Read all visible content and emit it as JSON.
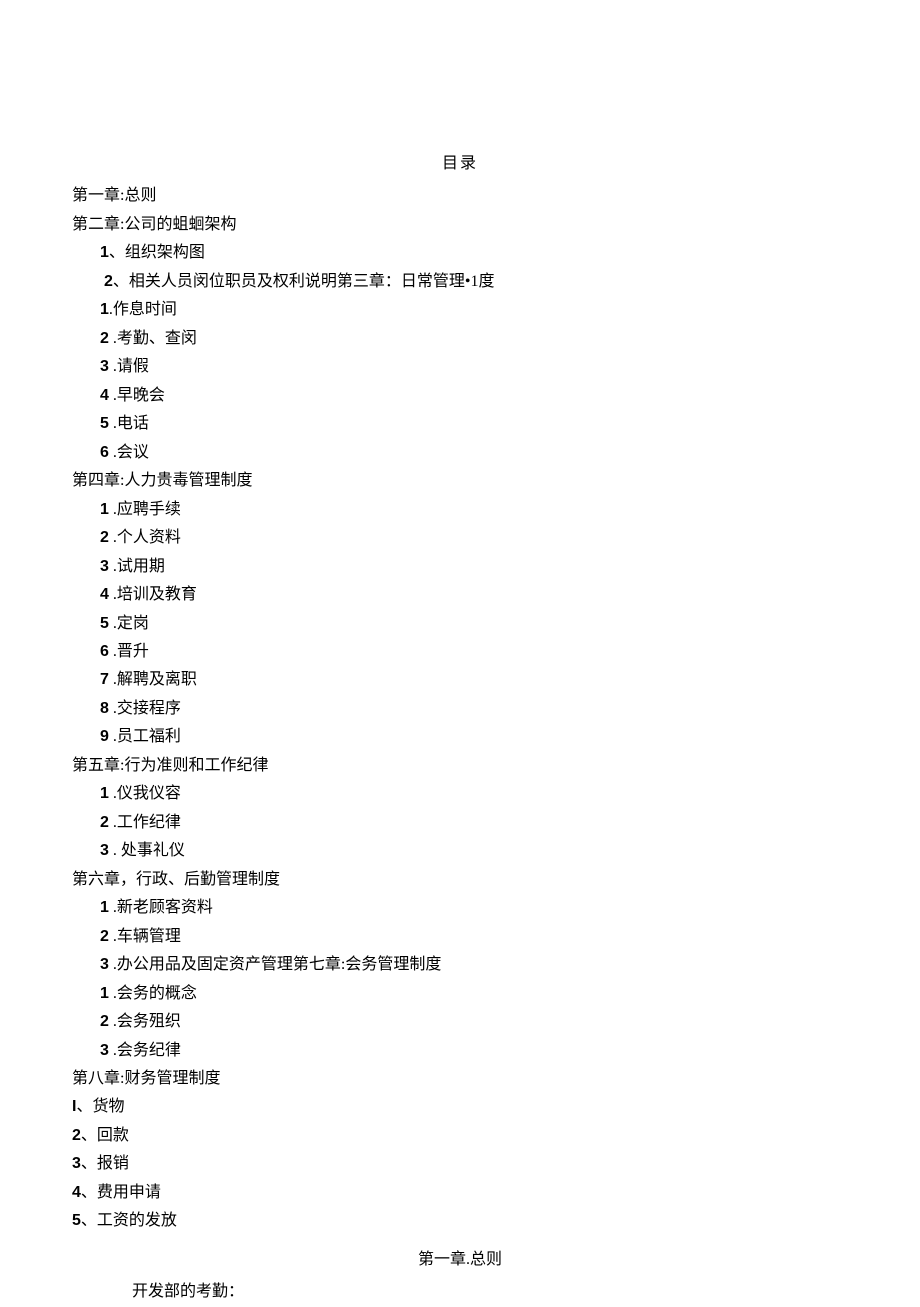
{
  "title": "目录",
  "ch1": "第一章:总则",
  "ch2": "第二章:公司的蛆蛔架构",
  "ch2_items": [
    {
      "n": "1",
      "sep": "、",
      "t": "组织架构图"
    },
    {
      "n": "2",
      "sep": "、",
      "t": "相关人员闵位职员及权利说明第三章：日常管理•1度"
    }
  ],
  "ch3_items": [
    {
      "n": "1",
      "t": ".作息时间"
    },
    {
      "n": "2",
      "t": " .考勤、查闵"
    },
    {
      "n": "3",
      "t": " .请假"
    },
    {
      "n": "4",
      "t": " .早晚会"
    },
    {
      "n": "5",
      "t": " .电话"
    },
    {
      "n": "6",
      "t": " .会议"
    }
  ],
  "ch4": "第四章:人力贵毒管理制度",
  "ch4_items": [
    {
      "n": "1",
      "t": " .应聘手续"
    },
    {
      "n": "2",
      "t": " .个人资料"
    },
    {
      "n": "3",
      "t": " .试用期"
    },
    {
      "n": "4",
      "t": " .培训及教育"
    },
    {
      "n": "5",
      "t": " .定岗"
    },
    {
      "n": "6",
      "t": " .晋升"
    },
    {
      "n": "7",
      "t": " .解聘及离职"
    },
    {
      "n": "8",
      "t": " .交接程序"
    },
    {
      "n": "9",
      "t": " .员工福利"
    }
  ],
  "ch5": "第五章:行为准则和工作纪律",
  "ch5_items": [
    {
      "n": "1",
      "t": " .仪我仪容"
    },
    {
      "n": "2",
      "t": " .工作纪律"
    },
    {
      "n": "3",
      "t": " . 处事礼仪"
    }
  ],
  "ch6": "第六章，行政、后勤管理制度",
  "ch6_items": [
    {
      "n": "1",
      "t": " .新老顾客资料"
    },
    {
      "n": "2",
      "t": " .车辆管理"
    },
    {
      "n": "3",
      "t": " .办公用品及固定资产管理第七章:会务管理制度"
    }
  ],
  "ch7_items": [
    {
      "n": "1",
      "t": " .会务的概念"
    },
    {
      "n": "2",
      "t": " .会务殂织"
    },
    {
      "n": "3",
      "t": " .会务纪律"
    }
  ],
  "ch8": "第八章:财务管理制度",
  "ch8_items": [
    {
      "n": "I",
      "sep": "、",
      "t": "货物"
    },
    {
      "n": "2",
      "sep": "、",
      "t": "回款"
    },
    {
      "n": "3",
      "sep": "、",
      "t": "报销"
    },
    {
      "n": "4",
      "sep": "、",
      "t": "费用申请"
    },
    {
      "n": "5",
      "sep": "、",
      "t": "工资的发放"
    }
  ],
  "chapter1_heading": "第一章.总则",
  "exam_text": "开发部的考勤："
}
